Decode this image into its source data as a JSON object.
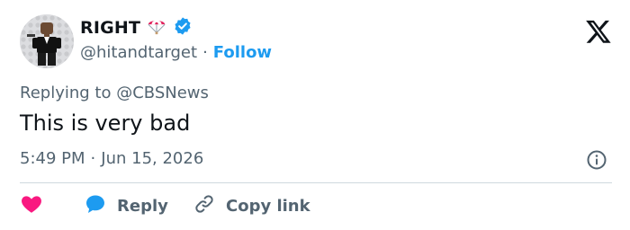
{
  "author": {
    "display_name": "RIGHT",
    "handle": "@hitandtarget",
    "separator": "·",
    "follow_label": "Follow"
  },
  "reply_context": {
    "prefix": "Replying to",
    "mention": "@CBSNews"
  },
  "tweet": {
    "text": "This is very bad",
    "time": "5:49 PM",
    "separator": "·",
    "date": "Jun 15, 2026"
  },
  "actions": {
    "reply_label": "Reply",
    "copy_link_label": "Copy link"
  },
  "colors": {
    "accent": "#1d9bf0",
    "like": "#f91880",
    "text": "#0f1419",
    "muted": "#536471",
    "divider": "#cfd9de"
  },
  "icons": {
    "brand": "x-logo-icon",
    "verified": "verified-badge-icon",
    "emoji": "parachute-emoji-icon",
    "info": "info-icon",
    "like": "heart-icon",
    "reply": "speech-bubble-icon",
    "copy": "link-icon"
  }
}
